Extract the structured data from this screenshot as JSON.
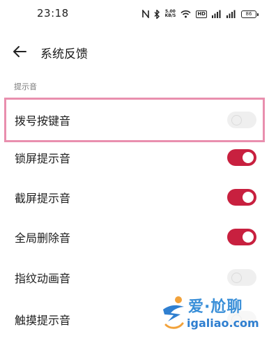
{
  "status_bar": {
    "time": "23:18",
    "net_speed_value": "5.00",
    "net_speed_unit": "KB/S",
    "hd_badge": "HD",
    "battery": "86"
  },
  "header": {
    "title": "系统反馈"
  },
  "section": {
    "label": "提示音"
  },
  "rows": [
    {
      "label": "拨号按键音",
      "state": "off"
    },
    {
      "label": "锁屏提示音",
      "state": "on"
    },
    {
      "label": "截屏提示音",
      "state": "on"
    },
    {
      "label": "全局删除音",
      "state": "on"
    },
    {
      "label": "指纹动画音",
      "state": "off"
    },
    {
      "label": "触摸提示音",
      "state": "off"
    }
  ],
  "colors": {
    "accent": "#c8203f",
    "highlight": "#e98fae",
    "toggle_off": "#eaeaea"
  },
  "watermark": {
    "top": "爱·尬聊",
    "bottom": "igaliao.com"
  }
}
